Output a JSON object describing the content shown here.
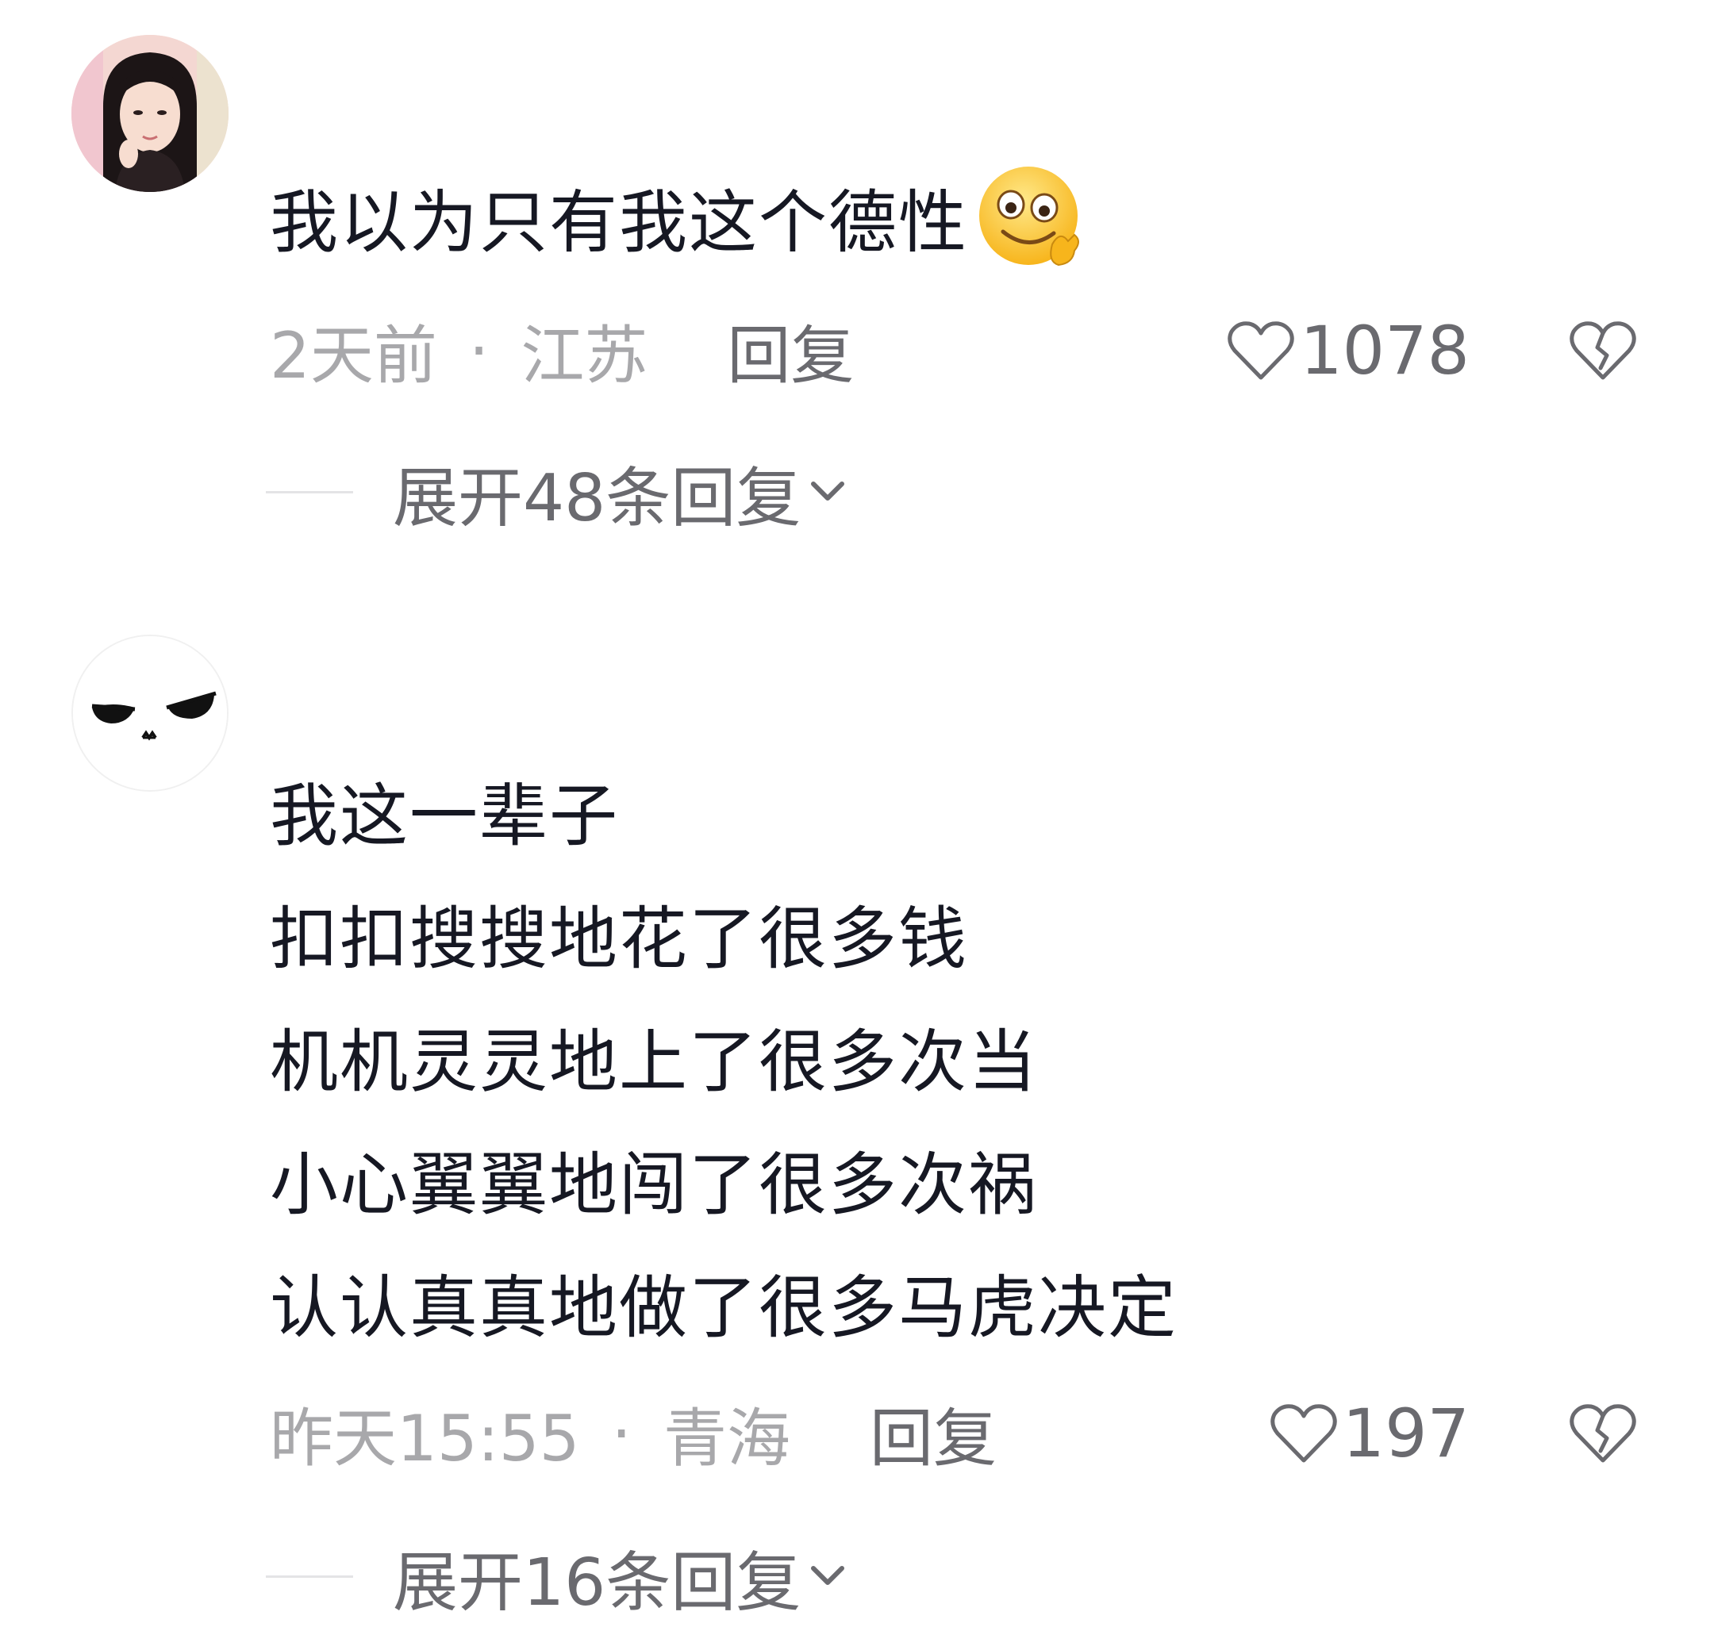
{
  "comments": [
    {
      "username": "",
      "text_lines": [
        "我以为只有我这个德性"
      ],
      "emoji": "thinking-wink-emoji",
      "time": "2天前",
      "location": "江苏",
      "reply_label": "回复",
      "likes": "1078",
      "expand_label": "展开48条回复"
    },
    {
      "username": "",
      "text_lines": [
        "我这一辈子",
        "扣扣搜搜地花了很多钱",
        "机机灵灵地上了很多次当",
        "小心翼翼地闯了很多次祸",
        "认认真真地做了很多马虎决定"
      ],
      "time": "昨天15:55",
      "location": "青海",
      "reply_label": "回复",
      "likes": "197",
      "expand_label": "展开16条回复"
    }
  ],
  "separator": "·",
  "icons": {
    "like": "heart-outline-icon",
    "dislike": "broken-heart-icon",
    "expand": "chevron-down-icon"
  },
  "colors": {
    "text_primary": "#161823",
    "text_secondary": "#a8a8ab",
    "text_action": "#6a6a6f"
  }
}
